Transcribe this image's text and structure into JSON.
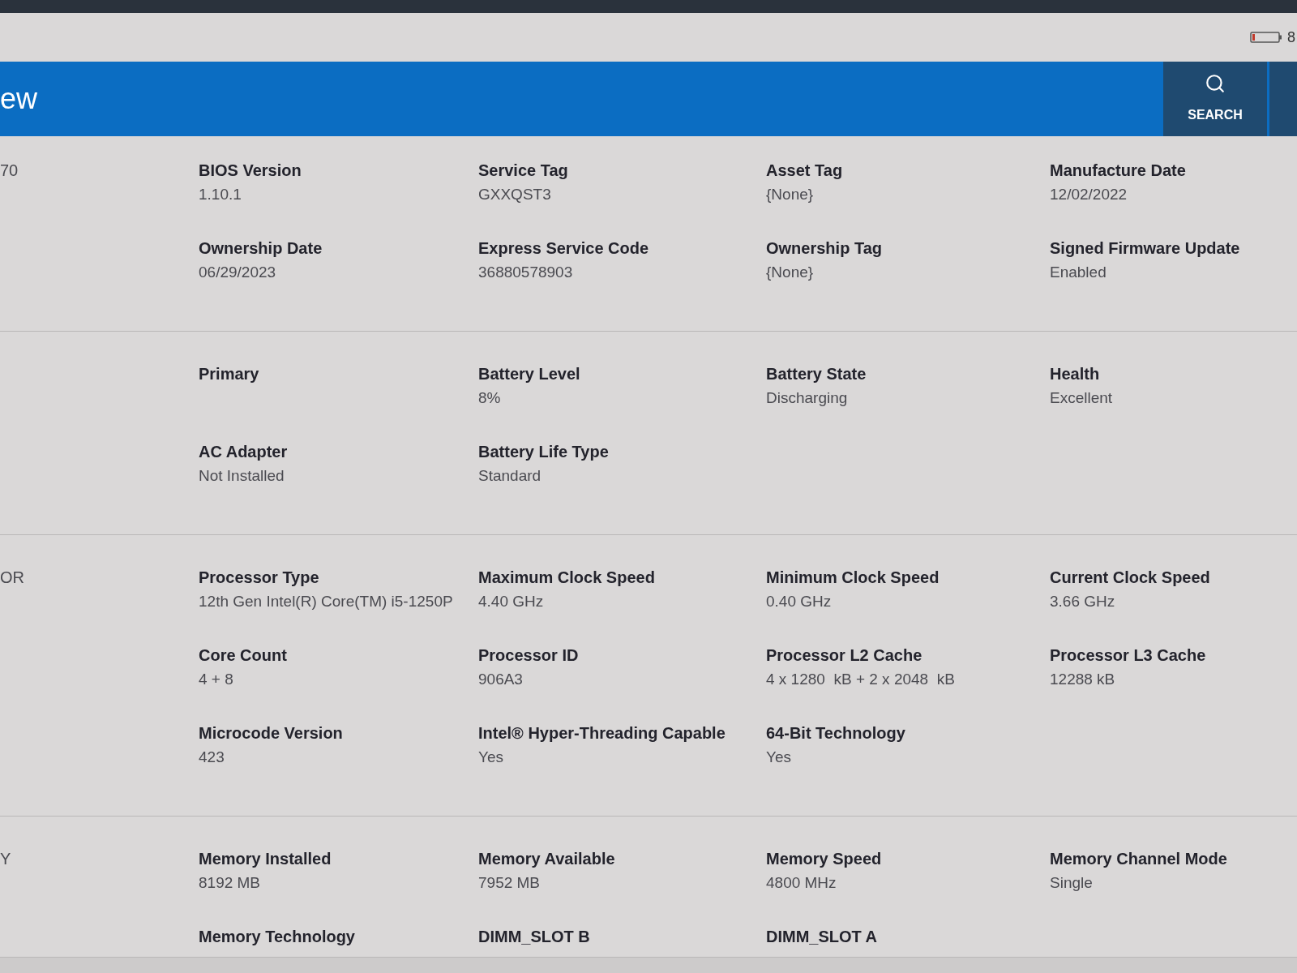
{
  "status_bar": {
    "battery_text": "8"
  },
  "header": {
    "title": "ew",
    "buttons": [
      {
        "kind": "search",
        "label": "SEARCH"
      },
      {
        "kind": "blank"
      }
    ]
  },
  "sections": [
    {
      "label": "70",
      "rows": [
        [
          {
            "label": "BIOS Version",
            "value": "1.10.1"
          },
          {
            "label": "Service Tag",
            "value": "GXXQST3"
          },
          {
            "label": "Asset Tag",
            "value": "{None}"
          },
          {
            "label": "Manufacture Date",
            "value": "12/02/2022"
          }
        ],
        [
          {
            "label": "Ownership Date",
            "value": "06/29/2023"
          },
          {
            "label": "Express Service Code",
            "value": "36880578903"
          },
          {
            "label": "Ownership Tag",
            "value": "{None}"
          },
          {
            "label": "Signed Firmware Update",
            "value": "Enabled"
          }
        ]
      ]
    },
    {
      "rows": [
        [
          {
            "label": "Primary"
          },
          {
            "label": "Battery Level",
            "value": "8%"
          },
          {
            "label": "Battery State",
            "value": "Discharging"
          },
          {
            "label": "Health",
            "value": "Excellent"
          }
        ],
        [
          {
            "label": "AC Adapter",
            "value": "Not Installed"
          },
          {
            "label": "Battery Life Type",
            "value": "Standard"
          }
        ]
      ]
    },
    {
      "label": "OR",
      "rows": [
        [
          {
            "label": "Processor Type",
            "value": "12th Gen Intel(R) Core(TM) i5-1250P"
          },
          {
            "label": "Maximum Clock Speed",
            "value": "4.40 GHz"
          },
          {
            "label": "Minimum Clock Speed",
            "value": "0.40 GHz"
          },
          {
            "label": "Current Clock Speed",
            "value": "3.66 GHz"
          }
        ],
        [
          {
            "label": "Core Count",
            "value": "4 + 8"
          },
          {
            "label": "Processor ID",
            "value": "906A3"
          },
          {
            "label": "Processor L2 Cache",
            "value": "4 x 1280  kB + 2 x 2048  kB"
          },
          {
            "label": "Processor L3 Cache",
            "value": "12288 kB"
          }
        ],
        [
          {
            "label": "Microcode Version",
            "value": "423"
          },
          {
            "label": "Intel® Hyper-Threading Capable",
            "value": "Yes"
          },
          {
            "label": "64-Bit Technology",
            "value": "Yes"
          }
        ]
      ]
    },
    {
      "label": "Y",
      "rows": [
        [
          {
            "label": "Memory Installed",
            "value": "8192 MB"
          },
          {
            "label": "Memory Available",
            "value": "7952 MB"
          },
          {
            "label": "Memory Speed",
            "value": "4800 MHz"
          },
          {
            "label": "Memory Channel Mode",
            "value": "Single"
          }
        ],
        [
          {
            "label": "Memory Technology"
          },
          {
            "label": "DIMM_SLOT B"
          },
          {
            "label": "DIMM_SLOT A"
          }
        ]
      ]
    }
  ]
}
